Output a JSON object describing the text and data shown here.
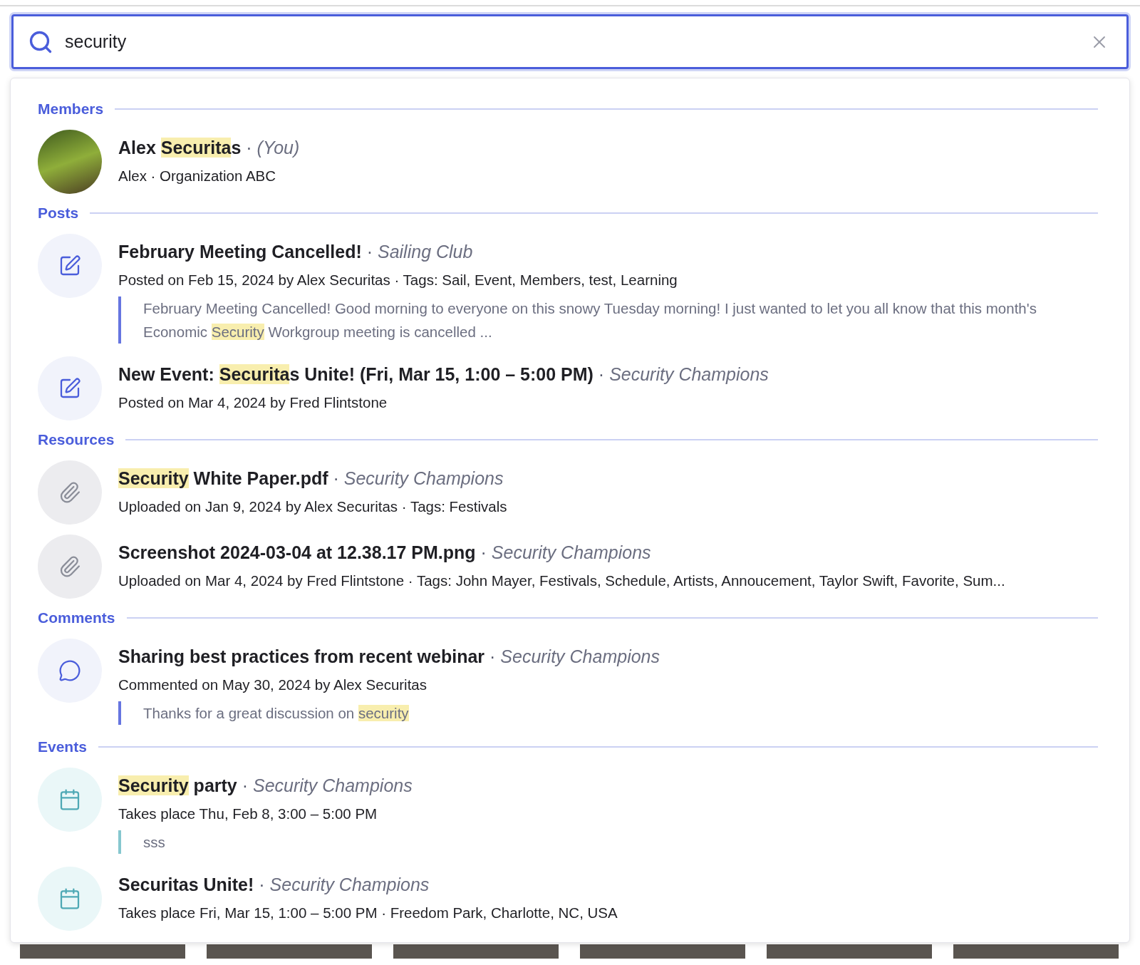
{
  "search": {
    "value": "security"
  },
  "sections": [
    {
      "title": "Members",
      "results": [
        {
          "kind": "member",
          "title": [
            {
              "text": "Alex ",
              "highlight": false
            },
            {
              "text": "Securita",
              "highlight": true
            },
            {
              "text": "s",
              "highlight": false
            }
          ],
          "separator": "·",
          "context": "(You)",
          "meta": "Alex · Organization ABC"
        }
      ]
    },
    {
      "title": "Posts",
      "results": [
        {
          "kind": "post",
          "title": [
            {
              "text": "February Meeting Cancelled!",
              "highlight": false
            }
          ],
          "separator": "·",
          "context": "Sailing Club",
          "meta": "Posted on Feb 15, 2024 by Alex Securitas · Tags: Sail, Event, Members, test, Learning",
          "excerpt": [
            {
              "text": "February Meeting Cancelled! Good morning to everyone on this snowy Tuesday morning! I just wanted to let you all know that this month's Economic ",
              "highlight": false
            },
            {
              "text": "Security",
              "highlight": true
            },
            {
              "text": " Workgroup meeting is cancelled ...",
              "highlight": false
            }
          ]
        },
        {
          "kind": "post",
          "title": [
            {
              "text": "New Event: ",
              "highlight": false
            },
            {
              "text": "Securita",
              "highlight": true
            },
            {
              "text": "s Unite! (Fri, Mar 15, 1:00 – 5:00 PM)",
              "highlight": false
            }
          ],
          "separator": "·",
          "context": "Security Champions",
          "meta": "Posted on Mar 4, 2024 by Fred Flintstone"
        }
      ]
    },
    {
      "title": "Resources",
      "results": [
        {
          "kind": "resource",
          "title": [
            {
              "text": "Security",
              "highlight": true
            },
            {
              "text": " White Paper.pdf",
              "highlight": false
            }
          ],
          "separator": "·",
          "context": "Security Champions",
          "meta": "Uploaded on Jan 9, 2024 by Alex Securitas · Tags: Festivals"
        },
        {
          "kind": "resource",
          "title": [
            {
              "text": "Screenshot 2024-03-04 at 12.38.17 PM.png",
              "highlight": false
            }
          ],
          "separator": "·",
          "context": "Security Champions",
          "meta": "Uploaded on Mar 4, 2024 by Fred Flintstone · Tags: John Mayer, Festivals, Schedule, Artists, Annoucement, Taylor Swift, Favorite, Sum..."
        }
      ]
    },
    {
      "title": "Comments",
      "results": [
        {
          "kind": "comment",
          "title": [
            {
              "text": "Sharing best practices from recent webinar",
              "highlight": false
            }
          ],
          "separator": "·",
          "context": "Security Champions",
          "meta": "Commented on May 30, 2024 by Alex Securitas",
          "excerpt": [
            {
              "text": "Thanks for a great discussion on ",
              "highlight": false
            },
            {
              "text": "security",
              "highlight": true
            }
          ]
        }
      ]
    },
    {
      "title": "Events",
      "results": [
        {
          "kind": "event",
          "title": [
            {
              "text": "Security",
              "highlight": true
            },
            {
              "text": " party",
              "highlight": false
            }
          ],
          "separator": "·",
          "context": "Security Champions",
          "meta": "Takes place Thu, Feb 8, 3:00 – 5:00 PM",
          "excerpt": [
            {
              "text": "sss",
              "highlight": false
            }
          ]
        },
        {
          "kind": "event",
          "title": [
            {
              "text": "Securitas Unite!",
              "highlight": false
            }
          ],
          "separator": "·",
          "context": "Security Champions",
          "meta": "Takes place Fri, Mar 15, 1:00 – 5:00 PM · Freedom Park, Charlotte, NC, USA"
        }
      ]
    }
  ]
}
